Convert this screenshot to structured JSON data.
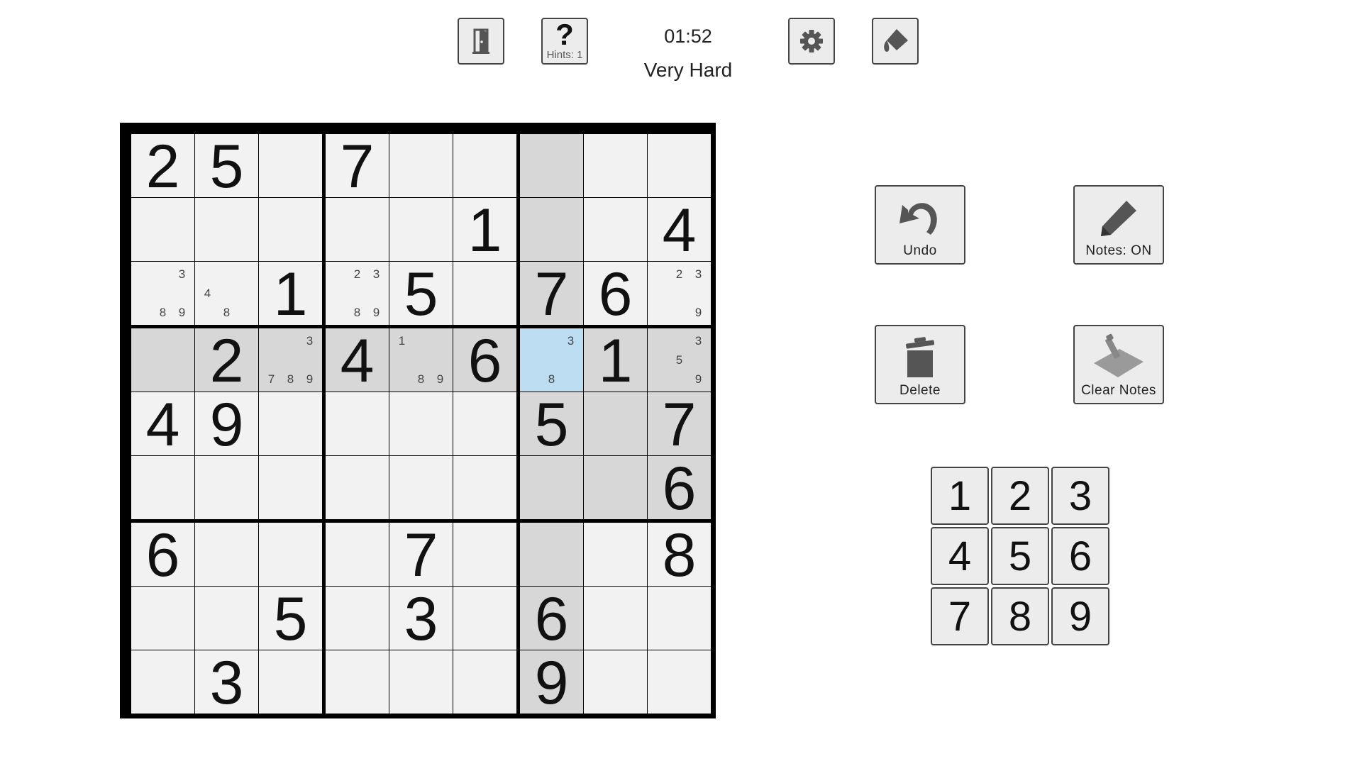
{
  "header": {
    "timer": "01:52",
    "difficulty": "Very Hard",
    "hints_label": "Hints: 1",
    "hint_symbol": "?",
    "icons": {
      "exit": "exit-door-icon",
      "hint": "question-mark-icon",
      "settings": "gear-icon",
      "theme": "paint-bucket-icon"
    }
  },
  "board": {
    "selected": [
      3,
      6
    ],
    "highlight": {
      "row": 3,
      "col": 6,
      "box": [
        3,
        6
      ]
    },
    "colors": {
      "cell": "#f2f2f2",
      "highlight": "#d7d7d7",
      "selected": "#bcdcf1",
      "grid": "#000000"
    },
    "values": [
      [
        "2",
        "5",
        "",
        "7",
        "",
        "",
        "",
        "",
        ""
      ],
      [
        "",
        "",
        "",
        "",
        "",
        "1",
        "",
        "",
        "4"
      ],
      [
        "",
        "",
        "1",
        "",
        "5",
        "",
        "7",
        "6",
        ""
      ],
      [
        "",
        "2",
        "",
        "4",
        "",
        "6",
        "",
        "1",
        ""
      ],
      [
        "4",
        "9",
        "",
        "",
        "",
        "",
        "5",
        "",
        "7"
      ],
      [
        "",
        "",
        "",
        "",
        "",
        "",
        "",
        "",
        "6"
      ],
      [
        "6",
        "",
        "",
        "",
        "7",
        "",
        "",
        "",
        "8"
      ],
      [
        "",
        "",
        "5",
        "",
        "3",
        "",
        "6",
        "",
        ""
      ],
      [
        "",
        "3",
        "",
        "",
        "",
        "",
        "9",
        "",
        ""
      ]
    ],
    "notes": [
      {
        "r": 2,
        "c": 0,
        "d": [
          3,
          8,
          9
        ]
      },
      {
        "r": 2,
        "c": 1,
        "d": [
          4,
          8
        ]
      },
      {
        "r": 2,
        "c": 3,
        "d": [
          2,
          3,
          8,
          9
        ]
      },
      {
        "r": 2,
        "c": 8,
        "d": [
          2,
          3,
          9
        ]
      },
      {
        "r": 3,
        "c": 2,
        "d": [
          3,
          7,
          8,
          9
        ]
      },
      {
        "r": 3,
        "c": 4,
        "d": [
          1,
          8,
          9
        ]
      },
      {
        "r": 3,
        "c": 6,
        "d": [
          3,
          8
        ]
      },
      {
        "r": 3,
        "c": 8,
        "d": [
          3,
          5,
          9
        ]
      }
    ]
  },
  "actions": {
    "undo": "Undo",
    "notes": "Notes: ON",
    "delete": "Delete",
    "clear_notes": "Clear Notes",
    "icons": {
      "undo": "undo-arrow-icon",
      "notes": "pencil-icon",
      "delete": "trash-icon",
      "clear_notes": "eraser-icon"
    }
  },
  "numpad": [
    "1",
    "2",
    "3",
    "4",
    "5",
    "6",
    "7",
    "8",
    "9"
  ]
}
